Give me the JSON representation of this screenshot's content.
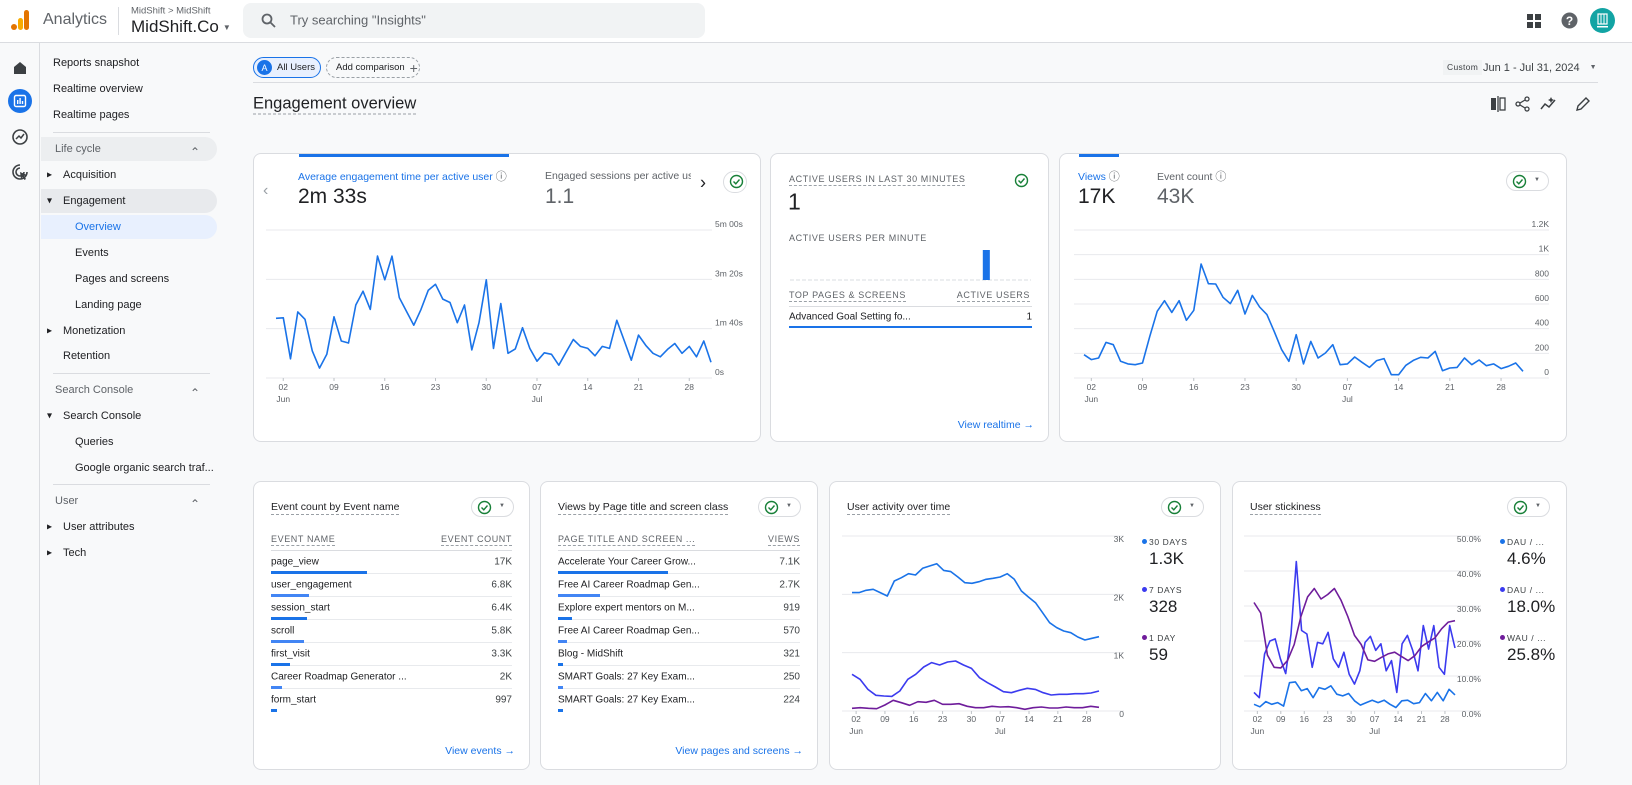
{
  "header": {
    "app_name": "Analytics",
    "breadcrumb": "MidShift > MidShift",
    "property": "MidShift.Co",
    "search_placeholder": "Try searching \"Insights\"",
    "icons": [
      "apps-grid-icon",
      "help-icon",
      "account-avatar"
    ]
  },
  "rail": {
    "icons": [
      "home-icon",
      "reports-icon",
      "explore-icon",
      "advertising-icon"
    ],
    "active": "reports-icon"
  },
  "sidebar": {
    "top": [
      "Reports snapshot",
      "Realtime overview",
      "Realtime pages"
    ],
    "sections": [
      {
        "title": "Life cycle",
        "items": [
          {
            "label": "Acquisition",
            "arrow": "right"
          },
          {
            "label": "Engagement",
            "arrow": "down",
            "children": [
              "Overview",
              "Events",
              "Pages and screens",
              "Landing page"
            ],
            "selected_child": "Overview"
          },
          {
            "label": "Monetization",
            "arrow": "right"
          },
          {
            "label": "Retention",
            "arrow": ""
          }
        ]
      },
      {
        "title": "Search Console",
        "items": [
          {
            "label": "Search Console",
            "arrow": "down",
            "children": [
              "Queries",
              "Google organic search traf..."
            ]
          }
        ]
      },
      {
        "title": "User",
        "items": [
          {
            "label": "User attributes",
            "arrow": "right"
          },
          {
            "label": "Tech",
            "arrow": "right"
          }
        ]
      }
    ]
  },
  "toolbar": {
    "segment_badge": "A",
    "segment": "All Users",
    "add_comparison": "Add comparison",
    "date_mode": "Custom",
    "date_range": "Jun 1 - Jul 31, 2024",
    "page_title": "Engagement overview",
    "actions": [
      "compare-icon",
      "share-icon",
      "insights-icon",
      "edit-icon"
    ]
  },
  "colors": {
    "accent": "#1a73e8",
    "seven_day": "#3b3bef",
    "purple": "#6f1d9b",
    "check": "#188038"
  },
  "date_ticks": {
    "labels": [
      "02",
      "09",
      "16",
      "23",
      "30",
      "07",
      "14",
      "21",
      "28"
    ],
    "months": {
      "02": "Jun",
      "07": "Jul"
    }
  },
  "engagement_card": {
    "metrics": [
      {
        "label": "Average engagement time per active user",
        "value": "2m 33s"
      },
      {
        "label": "Engaged sessions per active user",
        "value": "1.1"
      }
    ]
  },
  "realtime_card": {
    "title": "ACTIVE USERS IN LAST 30 MINUTES",
    "value": "1",
    "per_minute_label": "ACTIVE USERS PER MINUTE",
    "col_page": "TOP PAGES & SCREENS",
    "col_users": "ACTIVE USERS",
    "rows": [
      {
        "page": "Advanced Goal Setting fo...",
        "users": "1"
      }
    ],
    "link": "View realtime"
  },
  "views_card": {
    "metrics": [
      {
        "label": "Views",
        "value": "17K"
      },
      {
        "label": "Event count",
        "value": "43K"
      }
    ]
  },
  "events_card": {
    "title": "Event count by Event name",
    "col_name": "EVENT NAME",
    "col_value": "EVENT COUNT",
    "rows": [
      {
        "name": "page_view",
        "value": "17K",
        "n": 17000
      },
      {
        "name": "user_engagement",
        "value": "6.8K",
        "n": 6800
      },
      {
        "name": "session_start",
        "value": "6.4K",
        "n": 6400
      },
      {
        "name": "scroll",
        "value": "5.8K",
        "n": 5800
      },
      {
        "name": "first_visit",
        "value": "3.3K",
        "n": 3300
      },
      {
        "name": "Career Roadmap Generator ...",
        "value": "2K",
        "n": 2000
      },
      {
        "name": "form_start",
        "value": "997",
        "n": 997
      }
    ],
    "link": "View events"
  },
  "pages_card": {
    "title": "Views by Page title and screen class",
    "col_name": "PAGE TITLE AND SCREEN ...",
    "col_value": "VIEWS",
    "rows": [
      {
        "name": "Accelerate Your Career Grow...",
        "value": "7.1K",
        "n": 7100
      },
      {
        "name": "Free AI Career Roadmap Gen...",
        "value": "2.7K",
        "n": 2700
      },
      {
        "name": "Explore expert mentors on M...",
        "value": "919",
        "n": 919
      },
      {
        "name": "Free AI Career Roadmap Gen...",
        "value": "570",
        "n": 570
      },
      {
        "name": "Blog - MidShift",
        "value": "321",
        "n": 321
      },
      {
        "name": "SMART Goals: 27 Key Exam...",
        "value": "250",
        "n": 250
      },
      {
        "name": "SMART Goals: 27 Key Exam...",
        "value": "224",
        "n": 224
      }
    ],
    "link": "View pages and screens"
  },
  "activity_card": {
    "title": "User activity over time",
    "legend": [
      {
        "label": "30 DAYS",
        "value": "1.3K"
      },
      {
        "label": "7 DAYS",
        "value": "328"
      },
      {
        "label": "1 DAY",
        "value": "59"
      }
    ]
  },
  "stickiness_card": {
    "title": "User stickiness",
    "legend": [
      {
        "label": "DAU / ...",
        "value": "4.6%"
      },
      {
        "label": "DAU / ...",
        "value": "18.0%"
      },
      {
        "label": "WAU / ...",
        "value": "25.8%"
      }
    ]
  },
  "chart_data": [
    {
      "id": "engagement",
      "type": "line",
      "x_range": [
        "2024-06-01",
        "2024-07-31"
      ],
      "ylim": [
        0,
        300
      ],
      "yticks": [
        {
          "v": 0,
          "label": "0s"
        },
        {
          "v": 100,
          "label": "1m 40s"
        },
        {
          "v": 200,
          "label": "3m 20s"
        },
        {
          "v": 300,
          "label": "5m 00s"
        }
      ],
      "series": [
        {
          "values": [
            121,
            122,
            39,
            134,
            119,
            55,
            20,
            48,
            124,
            75,
            71,
            148,
            176,
            139,
            247,
            199,
            247,
            163,
            135,
            107,
            139,
            178,
            190,
            160,
            153,
            112,
            148,
            57,
            112,
            199,
            60,
            151,
            50,
            59,
            102,
            60,
            34,
            51,
            48,
            26,
            52,
            78,
            64,
            60,
            45,
            64,
            60,
            117,
            77,
            36,
            87,
            66,
            50,
            43,
            58,
            70,
            50,
            64,
            43,
            75,
            32
          ],
          "color": "#1a73e8"
        }
      ]
    },
    {
      "id": "realtime",
      "type": "bar",
      "values": [
        0,
        0,
        0,
        0,
        0,
        0,
        0,
        0,
        0,
        0,
        0,
        0,
        0,
        0,
        0,
        0,
        0,
        0,
        0,
        0,
        0,
        0,
        0,
        0,
        1,
        0,
        0,
        0,
        0,
        0
      ],
      "ylim": [
        0,
        1
      ]
    },
    {
      "id": "views",
      "type": "line",
      "x_range": [
        "2024-06-01",
        "2024-07-31"
      ],
      "ylim": [
        0,
        1200
      ],
      "yticks": [
        {
          "v": 0,
          "label": "0"
        },
        {
          "v": 200,
          "label": "200"
        },
        {
          "v": 400,
          "label": "400"
        },
        {
          "v": 600,
          "label": "600"
        },
        {
          "v": 800,
          "label": "800"
        },
        {
          "v": 1000,
          "label": "1K"
        },
        {
          "v": 1200,
          "label": "1.2K"
        }
      ],
      "series": [
        {
          "values": [
            189,
            149,
            162,
            289,
            270,
            135,
            114,
            108,
            122,
            338,
            541,
            627,
            532,
            627,
            468,
            549,
            924,
            765,
            762,
            654,
            603,
            711,
            519,
            670,
            576,
            514,
            378,
            230,
            135,
            351,
            114,
            297,
            162,
            203,
            270,
            108,
            114,
            170,
            127,
            86,
            141,
            157,
            27,
            27,
            103,
            143,
            168,
            162,
            216,
            59,
            81,
            86,
            162,
            108,
            146,
            100,
            114,
            76,
            95,
            122,
            54
          ],
          "color": "#1a73e8"
        }
      ]
    },
    {
      "id": "activity",
      "type": "line",
      "x_range": [
        "2024-06-01",
        "2024-07-31"
      ],
      "ylim": [
        0,
        3000
      ],
      "yticks": [
        {
          "v": 0,
          "label": "0"
        },
        {
          "v": 1000,
          "label": "1K"
        },
        {
          "v": 2000,
          "label": "2K"
        },
        {
          "v": 3000,
          "label": "3K"
        }
      ],
      "series": [
        {
          "name": "30 DAYS",
          "color": "#1a73e8",
          "values": [
            2029,
            2029,
            2069,
            2086,
            2029,
            1971,
            2229,
            2286,
            2354,
            2331,
            2446,
            2486,
            2526,
            2411,
            2389,
            2297,
            2200,
            2189,
            2217,
            2257,
            2274,
            2297,
            2354,
            2257,
            2057,
            1954,
            1857,
            1686,
            1514,
            1429,
            1371,
            1343,
            1269,
            1217,
            1246,
            1274
          ]
        },
        {
          "name": "7 DAYS",
          "color": "#3b3bef",
          "values": [
            629,
            543,
            371,
            269,
            257,
            251,
            343,
            543,
            629,
            754,
            829,
            789,
            840,
            857,
            789,
            731,
            571,
            486,
            411,
            331,
            314,
            354,
            389,
            371,
            314,
            274,
            286,
            286,
            297,
            297,
            309,
            343
          ]
        },
        {
          "name": "1 DAY",
          "color": "#6f1d9b",
          "values": [
            46,
            57,
            46,
            40,
            103,
            183,
            143,
            97,
            160,
            149,
            183,
            114,
            114,
            126,
            80,
            57,
            57,
            80,
            69,
            74,
            57,
            29,
            57,
            69,
            51,
            51,
            69,
            57,
            57,
            80,
            63
          ]
        }
      ]
    },
    {
      "id": "stickiness",
      "type": "line",
      "x_range": [
        "2024-06-01",
        "2024-07-31"
      ],
      "ylim": [
        0,
        50
      ],
      "yticks": [
        {
          "v": 0,
          "label": "0.0%"
        },
        {
          "v": 10,
          "label": "10.0%"
        },
        {
          "v": 20,
          "label": "20.0%"
        },
        {
          "v": 30,
          "label": "30.0%"
        },
        {
          "v": 40,
          "label": "40.0%"
        },
        {
          "v": 50,
          "label": "50.0%"
        }
      ],
      "series": [
        {
          "name": "DAU / MAU",
          "color": "#1a73e8",
          "values": [
            1.9,
            1.2,
            2.7,
            1.9,
            2.4,
            1.4,
            8.1,
            8.3,
            5.8,
            6.4,
            3.8,
            6.7,
            6.2,
            7.2,
            4.8,
            4.3,
            5.0,
            2.9,
            1.7,
            2.4,
            3.1,
            2.4,
            3.1,
            1.9,
            1.0,
            2.9,
            3.1,
            2.1,
            2.4,
            5.0,
            2.9,
            5.3,
            2.9,
            6.2,
            4.6
          ]
        },
        {
          "name": "DAU / WAU",
          "color": "#3b3bef",
          "values": [
            5.3,
            3.8,
            16.3,
            20,
            20.6,
            14.9,
            10.7,
            22,
            42.7,
            23,
            22,
            12.5,
            19.6,
            19.2,
            22.5,
            14.9,
            12.5,
            16.8,
            10.5,
            7.7,
            11.5,
            19.6,
            21.3,
            17.3,
            19.2,
            11.5,
            14.4,
            5.3,
            19.2,
            21.6,
            17.3,
            11.5,
            24.4,
            17.7,
            24.4,
            12.5,
            10.5,
            24.4,
            18.0
          ]
        },
        {
          "name": "WAU / MAU",
          "color": "#6f1d9b",
          "values": [
            31,
            28,
            16,
            12.5,
            12.3,
            14.4,
            19,
            27,
            32.6,
            35,
            32,
            33.3,
            35,
            31.6,
            27,
            21.6,
            19,
            14.6,
            14.2,
            15.3,
            16.3,
            16.8,
            15.6,
            14.4,
            15.8,
            18.4,
            19.7,
            20.9,
            23.5,
            25.4,
            25.8
          ]
        }
      ]
    }
  ]
}
